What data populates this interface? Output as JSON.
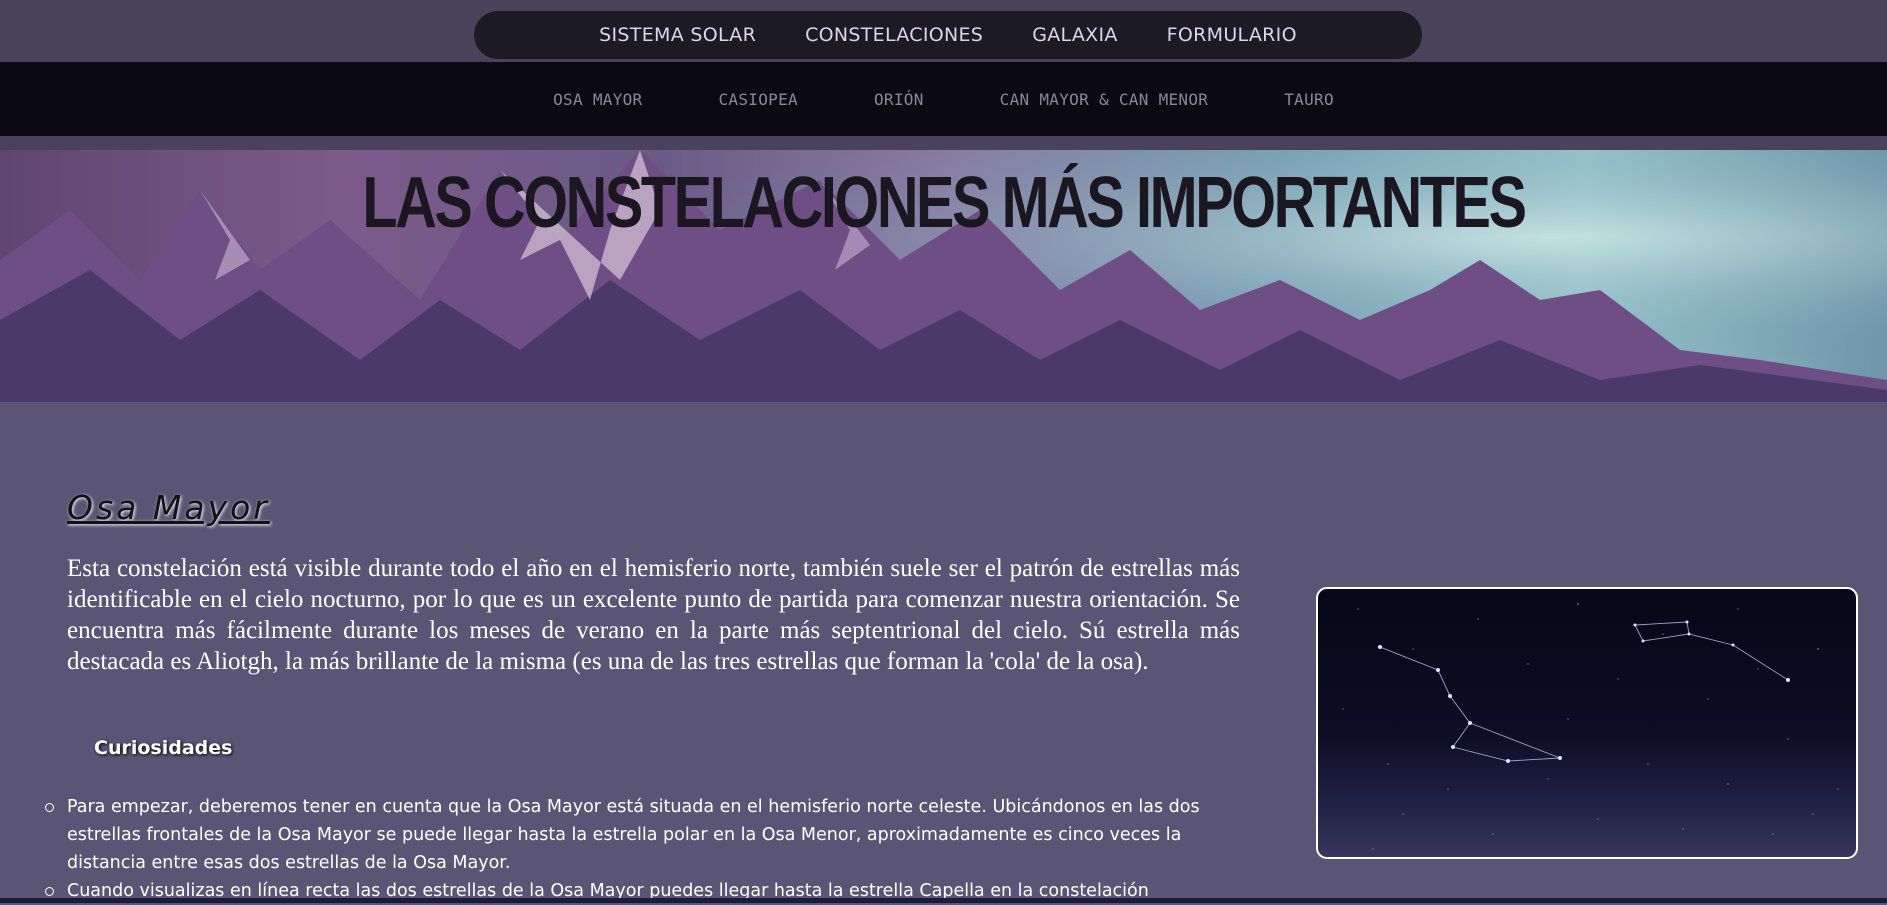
{
  "main_nav": [
    "SISTEMA SOLAR",
    "CONSTELACIONES",
    "GALAXIA",
    "FORMULARIO"
  ],
  "sub_nav": [
    "OSA MAYOR",
    "CASIOPEA",
    "ORIÓN",
    "CAN MAYOR & CAN MENOR",
    "TAURO"
  ],
  "hero": {
    "title": "LAS CONSTELACIONES MÁS IMPORTANTES"
  },
  "section": {
    "title": "Osa Mayor",
    "intro": "Esta constelación está visible durante todo el año en el hemisferio norte, también suele ser el patrón de estrellas más identificable en el cielo nocturno, por lo que es un excelente punto de partida para comenzar nuestra orientación. Se encuentra más fácilmente durante los meses de verano en la parte más septentrional del cielo. Sú estrella más destacada es Aliotgh, la más brillante de la misma (es una de las tres estrellas que forman la 'cola' de la osa).",
    "subtitle": "Curiosidades",
    "facts": [
      "Para empezar, deberemos tener en cuenta que la Osa Mayor está situada en el hemisferio norte celeste. Ubicándonos en las dos estrellas frontales de la Osa Mayor se puede llegar hasta la estrella polar en la Osa Menor, aproximadamente es cinco veces la distancia entre esas dos estrellas de la Osa Mayor.",
      "Cuando visualizas en línea recta las dos estrellas de la Osa Mayor puedes llegar hasta la estrella Capella en la constelación"
    ]
  },
  "colors": {
    "page_bg": "#5b5575",
    "topbar_bg": "#48435a",
    "nav_pill_bg": "#1c1b24",
    "subnav_bg": "#0b0a13",
    "hero_title": "#1a1720"
  },
  "icons": {
    "bullet": "circle-bullet-icon"
  }
}
